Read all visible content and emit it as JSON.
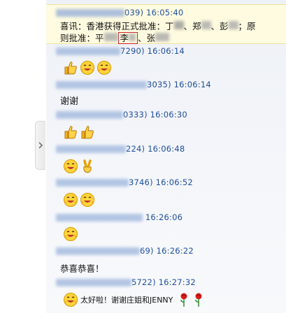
{
  "messages": [
    {
      "sender_suffix": "039)",
      "time": "16:05:40",
      "text_line1": "喜讯：香港获得正式批准：丁",
      "text_l1_rest": "、郑",
      "text_l1_rest2": "、彭",
      "text_l1_end": "；原",
      "text_line2": "则批准：平",
      "boxed": "李",
      "text_l2_end": "、张"
    },
    {
      "sender_suffix": "7290)",
      "time": "16:06:14"
    },
    {
      "sender_suffix": "3035)",
      "time": "16:06:14",
      "text": "谢谢"
    },
    {
      "sender_suffix": "0333)",
      "time": "16:06:30"
    },
    {
      "sender_suffix": "224)",
      "time": "16:06:48"
    },
    {
      "sender_suffix": "3746)",
      "time": "16:06:52"
    },
    {
      "sender_suffix": "",
      "time": "16:26:06"
    },
    {
      "sender_suffix": "69)",
      "time": "16:26:22",
      "text": "恭喜恭喜！"
    },
    {
      "sender_suffix": "5722)",
      "time": "16:27:32",
      "text": "太好啦！谢谢庄姐和JENNY"
    }
  ],
  "emoji_names": [
    "thumbs-up-icon",
    "laughing-face-icon",
    "victory-hand-icon",
    "rose-icon"
  ]
}
